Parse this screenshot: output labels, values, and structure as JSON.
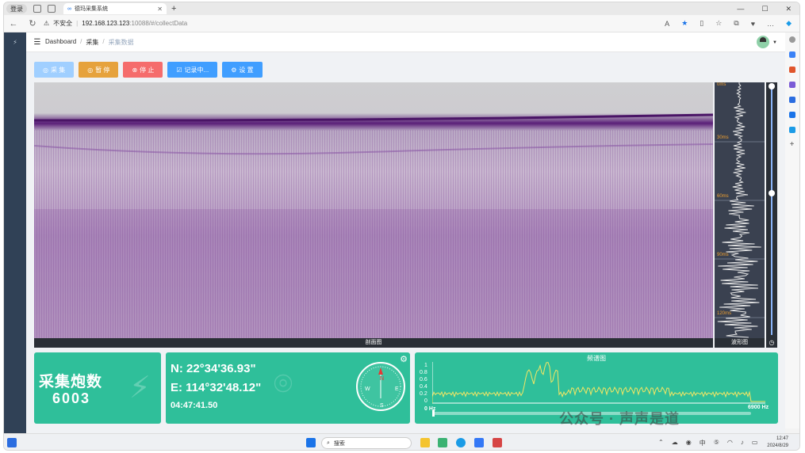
{
  "browser": {
    "profile_label": "登录",
    "tab_title": "德玛采集系统",
    "url_warning": "不安全",
    "url_host": "192.168.123.123",
    "url_path": ":10088/#/collectData"
  },
  "breadcrumb": {
    "items": [
      "Dashboard",
      "采集",
      "采集数据"
    ]
  },
  "toolbar": {
    "collect": "采 集",
    "pause": "暂 停",
    "stop": "停 止",
    "recording": "记录中...",
    "settings": "设 置"
  },
  "profile": {
    "label": "剖面图"
  },
  "wave": {
    "label": "波形图",
    "marks": [
      "0ms",
      "30ms",
      "60ms",
      "90ms",
      "120ms"
    ]
  },
  "shots": {
    "title": "采集炮数",
    "value": "6003"
  },
  "position": {
    "n": "N:  22°34'36.93\"",
    "e": "E:  114°32'48.12\"",
    "time": "04:47:41.50"
  },
  "compass": {
    "n": "N",
    "s": "S",
    "e": "E",
    "w": "W"
  },
  "spectrum": {
    "title": "频谱图",
    "y_ticks": [
      "1",
      "0.8",
      "0.6",
      "0.4",
      "0.2",
      "0"
    ],
    "x_min": "0 Hz",
    "x_max": "6900 Hz"
  },
  "taskbar": {
    "search": "搜索",
    "time": "12:47",
    "date": "2024/8/29"
  },
  "watermark": "公众号 · 声声是道",
  "colors": {
    "accent": "#2fbf9a",
    "purple": "#6e2a86"
  }
}
